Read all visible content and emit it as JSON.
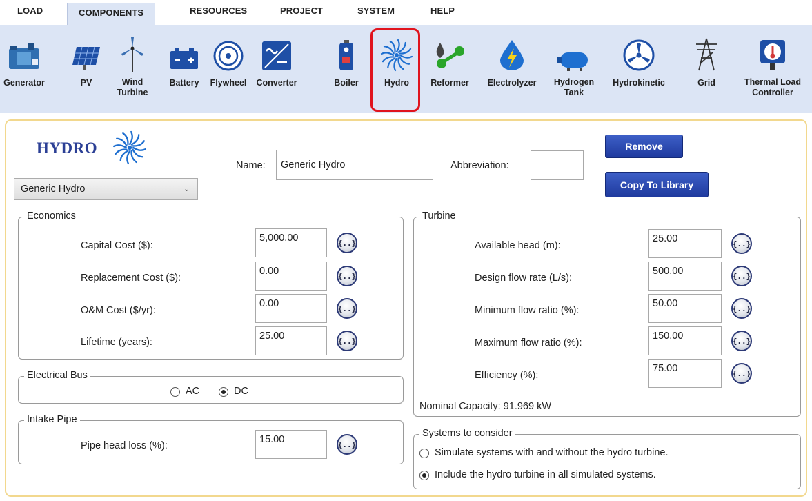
{
  "tabs": [
    "LOAD",
    "COMPONENTS",
    "RESOURCES",
    "PROJECT",
    "SYSTEM",
    "HELP"
  ],
  "active_tab": "COMPONENTS",
  "ribbon": [
    {
      "label": "Generator",
      "icon": "generator-icon"
    },
    {
      "label": "PV",
      "icon": "pv-panel-icon"
    },
    {
      "label": "Wind\nTurbine",
      "icon": "wind-turbine-icon"
    },
    {
      "label": "Battery",
      "icon": "battery-icon"
    },
    {
      "label": "Flywheel",
      "icon": "flywheel-icon"
    },
    {
      "label": "Converter",
      "icon": "converter-icon"
    },
    {
      "label": "Boiler",
      "icon": "boiler-icon"
    },
    {
      "label": "Hydro",
      "icon": "hydro-icon"
    },
    {
      "label": "Reformer",
      "icon": "reformer-icon"
    },
    {
      "label": "Electrolyzer",
      "icon": "electrolyzer-icon"
    },
    {
      "label": "Hydrogen\nTank",
      "icon": "hydrogen-tank-icon"
    },
    {
      "label": "Hydrokinetic",
      "icon": "hydrokinetic-icon"
    },
    {
      "label": "Grid",
      "icon": "grid-icon"
    },
    {
      "label": "Thermal Load\nController",
      "icon": "thermal-load-controller-icon"
    }
  ],
  "colors": {
    "ribbon_bg": "#dce5f5",
    "highlight": "#e0141e",
    "panel_border": "#f2d88e",
    "button_blue": "#2a47b0",
    "hydro_title": "#2b3f95"
  },
  "header": {
    "title": "HYDRO",
    "name_label": "Name:",
    "name_value": "Generic Hydro",
    "abbreviation_label": "Abbreviation:",
    "abbreviation_value": "",
    "preset_selected": "Generic Hydro",
    "remove_button": "Remove",
    "copy_button": "Copy To Library"
  },
  "fx_label": "{..}",
  "economics": {
    "title": "Economics",
    "fields": [
      {
        "label": "Capital Cost ($):",
        "value": "5,000.00"
      },
      {
        "label": "Replacement Cost ($):",
        "value": "0.00"
      },
      {
        "label": "O&M Cost ($/yr):",
        "value": "0.00"
      },
      {
        "label": "Lifetime (years):",
        "value": "25.00"
      }
    ]
  },
  "electrical_bus": {
    "title": "Electrical Bus",
    "options": [
      "AC",
      "DC"
    ],
    "selected": "DC"
  },
  "intake_pipe": {
    "title": "Intake Pipe",
    "fields": [
      {
        "label": "Pipe head loss (%):",
        "value": "15.00"
      }
    ]
  },
  "turbine": {
    "title": "Turbine",
    "fields": [
      {
        "label": "Available head (m):",
        "value": "25.00"
      },
      {
        "label": "Design flow rate (L/s):",
        "value": "500.00"
      },
      {
        "label": "Minimum flow ratio (%):",
        "value": "50.00"
      },
      {
        "label": "Maximum flow ratio (%):",
        "value": "150.00"
      },
      {
        "label": "Efficiency (%):",
        "value": "75.00"
      }
    ],
    "nominal_capacity": "Nominal Capacity: 91.969 kW"
  },
  "systems": {
    "title": "Systems to consider",
    "options": [
      "Simulate systems with and without the hydro turbine.",
      "Include the hydro turbine in all simulated systems."
    ],
    "selected_index": 1
  }
}
